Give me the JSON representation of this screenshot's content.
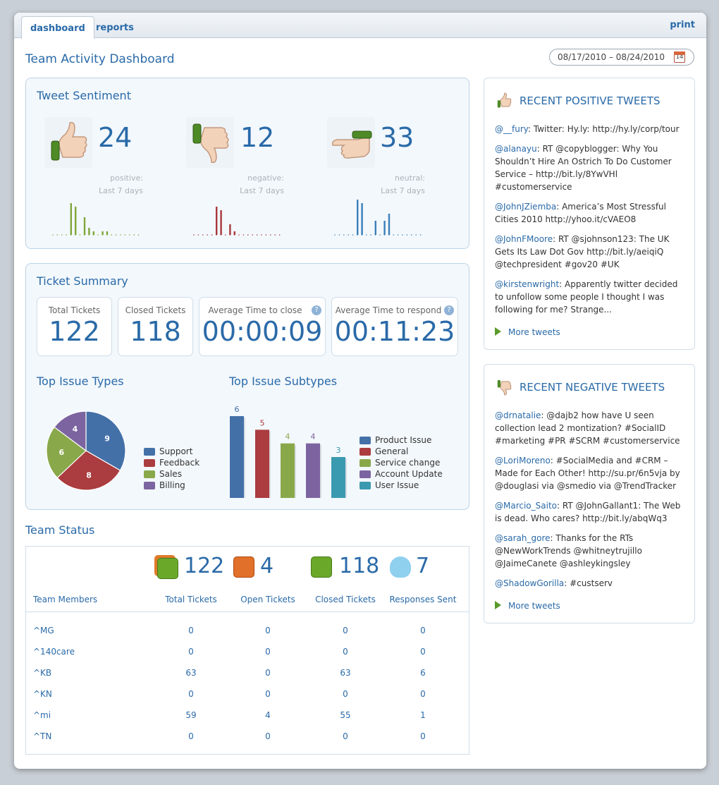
{
  "tabs": {
    "dashboard": "dashboard",
    "reports": "reports",
    "print": "print"
  },
  "page_title": "Team Activity Dashboard",
  "date_range": "08/17/2010 – 08/24/2010",
  "calendar_day": "14",
  "sentiment": {
    "title": "Tweet Sentiment",
    "positive": {
      "count": "24",
      "label": "positive:",
      "period": "Last 7 days",
      "bars": [
        0,
        0,
        0,
        0,
        9,
        8,
        0,
        5,
        2,
        1,
        0,
        1,
        1,
        0,
        0,
        0,
        0,
        0,
        0,
        0
      ]
    },
    "negative": {
      "count": "12",
      "label": "negative:",
      "period": "Last 7 days",
      "bars": [
        0,
        0,
        0,
        0,
        0,
        8,
        7,
        0,
        3,
        1,
        0,
        0,
        0,
        0,
        0,
        0,
        0,
        0,
        0,
        0
      ]
    },
    "neutral": {
      "count": "33",
      "label": "neutral:",
      "period": "Last 7 days",
      "bars": [
        0,
        0,
        0,
        0,
        0,
        10,
        9,
        0,
        0,
        4,
        0,
        4,
        6,
        0,
        0,
        0,
        0,
        0,
        0,
        0
      ]
    },
    "colors": {
      "positive": "#7fa63a",
      "negative": "#a8373b",
      "neutral": "#3b7fb9"
    }
  },
  "tickets": {
    "title": "Ticket Summary",
    "total": {
      "label": "Total Tickets",
      "value": "122"
    },
    "closed": {
      "label": "Closed Tickets",
      "value": "118"
    },
    "avg_close": {
      "label": "Average Time to close",
      "value": "00:00:09"
    },
    "avg_respond": {
      "label": "Average Time to respond",
      "value": "00:11:23"
    },
    "help_glyph": "?"
  },
  "chart_data": [
    {
      "type": "pie",
      "title": "Top Issue Types",
      "categories": [
        "Support",
        "Feedback",
        "Sales",
        "Billing"
      ],
      "values": [
        9,
        8,
        6,
        4
      ],
      "colors": [
        "#4470a8",
        "#ab3c3f",
        "#89a84a",
        "#7c64a0"
      ]
    },
    {
      "type": "bar",
      "title": "Top Issue Subtypes",
      "categories": [
        "Product Issue",
        "General",
        "Service change",
        "Account Update",
        "User Issue"
      ],
      "values": [
        6,
        5,
        4,
        4,
        3
      ],
      "colors": [
        "#4470a8",
        "#ab3c3f",
        "#89a84a",
        "#7c64a0",
        "#3a9ab0"
      ],
      "ylim": [
        0,
        6
      ]
    }
  ],
  "team": {
    "title": "Team Status",
    "summary": [
      {
        "value": "122",
        "color": "#6aa82a",
        "icon": "stacked-tickets-icon"
      },
      {
        "value": "4",
        "color": "#e0702a",
        "icon": "open-ticket-icon"
      },
      {
        "value": "118",
        "color": "#6aa82a",
        "icon": "closed-ticket-icon"
      },
      {
        "value": "7",
        "color": "#5bb8e0",
        "icon": "twitter-bird-icon"
      }
    ],
    "headers": [
      "Team Members",
      "Total Tickets",
      "Open Tickets",
      "Closed Tickets",
      "Responses Sent"
    ],
    "rows": [
      [
        "^MG",
        "0",
        "0",
        "0",
        "0"
      ],
      [
        "^140care",
        "0",
        "0",
        "0",
        "0"
      ],
      [
        "^KB",
        "63",
        "0",
        "63",
        "6"
      ],
      [
        "^KN",
        "0",
        "0",
        "0",
        "0"
      ],
      [
        "^mi",
        "59",
        "4",
        "55",
        "1"
      ],
      [
        "^TN",
        "0",
        "0",
        "0",
        "0"
      ]
    ]
  },
  "positive_tweets": {
    "title": "RECENT POSITIVE TWEETS",
    "items": [
      {
        "user": "@__fury",
        "text": ": Twitter: Hy.ly: http://hy.ly/corp/tour"
      },
      {
        "user": "@alanayu",
        "text": ": RT @copyblogger: Why You Shouldn’t Hire An Ostrich To Do Customer Service – http://bit.ly/8YwVHl #customerservice"
      },
      {
        "user": "@JohnJZiemba",
        "text": ": America’s Most Stressful Cities 2010 http://yhoo.it/cVAEO8"
      },
      {
        "user": "@JohnFMoore",
        "text": ": RT @sjohnson123: The UK Gets Its Law Dot Gov http://bit.ly/aeiqiQ @techpresident #gov20 #UK"
      },
      {
        "user": "@kirstenwright",
        "text": ": Apparently twitter decided to unfollow some people I thought I was following for me? Strange..."
      }
    ],
    "more": "More tweets"
  },
  "negative_tweets": {
    "title": "RECENT NEGATIVE TWEETS",
    "items": [
      {
        "user": "@drnatalie",
        "text": ": @dajb2 how have U seen collection lead 2 montization? #SocialID #marketing #PR #SCRM #customerservice"
      },
      {
        "user": "@LoriMoreno",
        "text": ": #SocialMedia and #CRM – Made for Each Other! http://su.pr/6n5vja by @douglasi via @smedio via @TrendTracker"
      },
      {
        "user": "@Marcio_Saito",
        "text": ": RT @JohnGallant1: The Web is dead. Who cares? http://bit.ly/abqWq3"
      },
      {
        "user": "@sarah_gore",
        "text": ": Thanks for the RTs @NewWorkTrends @whitneytrujillo @JaimeCanete @ashleykingsley"
      },
      {
        "user": "@ShadowGorilla",
        "text": ": #custserv"
      }
    ],
    "more": "More tweets"
  }
}
